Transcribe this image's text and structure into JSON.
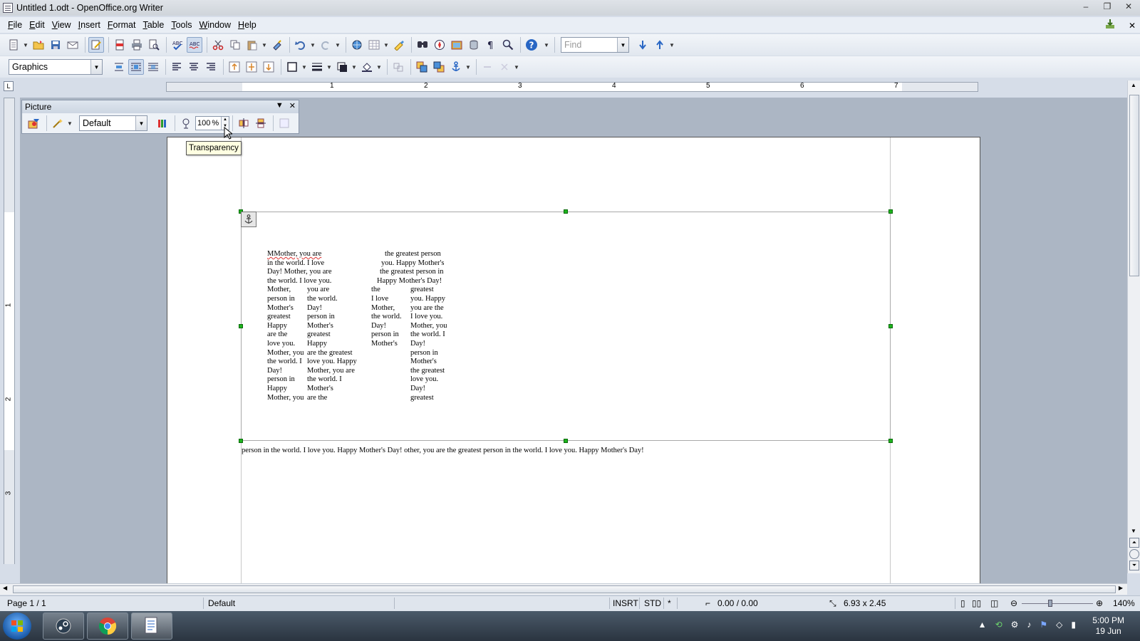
{
  "window": {
    "title": "Untitled 1.odt - OpenOffice.org Writer",
    "controls": [
      "–",
      "❐",
      "✕"
    ]
  },
  "menu": {
    "items": [
      {
        "first": "F",
        "rest": "ile"
      },
      {
        "first": "E",
        "rest": "dit"
      },
      {
        "first": "V",
        "rest": "iew"
      },
      {
        "first": "I",
        "rest": "nsert"
      },
      {
        "first": "F",
        "rest": "ormat"
      },
      {
        "first": "T",
        "rest": "able"
      },
      {
        "first": "T",
        "rest": "ools"
      },
      {
        "first": "W",
        "rest": "indow"
      },
      {
        "first": "H",
        "rest": "elp"
      }
    ],
    "close_doc": "✕"
  },
  "toolbar": {
    "find_placeholder": "Find",
    "style_value": "Graphics"
  },
  "ruler": {
    "h_numbers": [
      "1",
      "2",
      "3",
      "4",
      "5",
      "6",
      "7"
    ],
    "v_numbers": [
      "1",
      "2",
      "3"
    ],
    "corner": "L"
  },
  "picture_toolbar": {
    "title": "Picture",
    "graphics_mode": "Default",
    "transparency_value": "100",
    "transparency_unit": "%",
    "tooltip": "Transparency"
  },
  "document": {
    "poem_lines": [
      {
        "text": "MMother, you are",
        "row": 0,
        "col": 0
      },
      {
        "text": "the greatest person",
        "row": 0,
        "col": 3
      },
      {
        "text": "in the world. I love",
        "row": 1,
        "col": 0
      },
      {
        "text": "you. Happy Mother's",
        "row": 1,
        "col": 3
      },
      {
        "text": "Day! Mother, you are",
        "row": 2,
        "col": 0
      },
      {
        "text": "the greatest person in",
        "row": 2,
        "col": 3
      },
      {
        "text": "the world. I love you.",
        "row": 3,
        "col": 0
      },
      {
        "text": "Happy Mother's Day!",
        "row": 3,
        "col": 3
      },
      {
        "text": "Mother,",
        "row": 4,
        "col": 0
      },
      {
        "text": "you are",
        "row": 4,
        "col": 1
      },
      {
        "text": "the",
        "row": 4,
        "col": 2
      },
      {
        "text": "greatest",
        "row": 4,
        "col": 4
      },
      {
        "text": "person in",
        "row": 5,
        "col": 0
      },
      {
        "text": "the world.",
        "row": 5,
        "col": 1
      },
      {
        "text": "I love",
        "row": 5,
        "col": 2
      },
      {
        "text": "you. Happy",
        "row": 5,
        "col": 4
      },
      {
        "text": "Mother's",
        "row": 6,
        "col": 0
      },
      {
        "text": "Day!",
        "row": 6,
        "col": 1
      },
      {
        "text": "Mother,",
        "row": 6,
        "col": 2
      },
      {
        "text": "you are the",
        "row": 6,
        "col": 4
      },
      {
        "text": "greatest",
        "row": 7,
        "col": 0
      },
      {
        "text": "person in",
        "row": 7,
        "col": 1
      },
      {
        "text": "the world.",
        "row": 7,
        "col": 2
      },
      {
        "text": "I love you.",
        "row": 7,
        "col": 4
      },
      {
        "text": "Happy",
        "row": 8,
        "col": 0
      },
      {
        "text": "Mother's",
        "row": 8,
        "col": 1
      },
      {
        "text": "Day!",
        "row": 8,
        "col": 2
      },
      {
        "text": "Mother, you",
        "row": 8,
        "col": 4
      },
      {
        "text": "are the",
        "row": 9,
        "col": 0
      },
      {
        "text": "greatest",
        "row": 9,
        "col": 1
      },
      {
        "text": "person in",
        "row": 9,
        "col": 2
      },
      {
        "text": "the world. I",
        "row": 9,
        "col": 4
      },
      {
        "text": "love you.",
        "row": 10,
        "col": 0
      },
      {
        "text": "Happy",
        "row": 10,
        "col": 1
      },
      {
        "text": "Mother's",
        "row": 10,
        "col": 2
      },
      {
        "text": "Day!",
        "row": 10,
        "col": 4
      },
      {
        "text": "Mother, you",
        "row": 11,
        "col": 0
      },
      {
        "text": "are the greatest",
        "row": 11,
        "col": 1
      },
      {
        "text": "person in",
        "row": 11,
        "col": 4
      },
      {
        "text": "the world. I",
        "row": 12,
        "col": 0
      },
      {
        "text": "love you. Happy",
        "row": 12,
        "col": 1
      },
      {
        "text": "Mother's",
        "row": 12,
        "col": 4
      },
      {
        "text": "Day!",
        "row": 13,
        "col": 0
      },
      {
        "text": "Mother, you are",
        "row": 13,
        "col": 1
      },
      {
        "text": "the greatest",
        "row": 13,
        "col": 4
      },
      {
        "text": "person in",
        "row": 14,
        "col": 0
      },
      {
        "text": "the world. I",
        "row": 14,
        "col": 1
      },
      {
        "text": "love you.",
        "row": 14,
        "col": 4
      },
      {
        "text": "Happy",
        "row": 15,
        "col": 0
      },
      {
        "text": "Mother's",
        "row": 15,
        "col": 1
      },
      {
        "text": "Day!",
        "row": 15,
        "col": 4
      },
      {
        "text": "Mother, you",
        "row": 16,
        "col": 0
      },
      {
        "text": "are the",
        "row": 16,
        "col": 1
      },
      {
        "text": "greatest",
        "row": 16,
        "col": 4
      }
    ],
    "body_text": "person in the world. I love you. Happy Mother's Day! other, you are the greatest person in the world. I love you. Happy Mother's Day!"
  },
  "status": {
    "page": "Page 1 / 1",
    "style": "Default",
    "insert_mode": "INSRT",
    "selection_mode": "STD",
    "modified": "*",
    "position": "0.00 / 0.00",
    "size": "6.93 x 2.45",
    "zoom": "140%",
    "zoom_level": 0.4
  },
  "taskbar": {
    "time": "5:00 PM",
    "date": "19 Jun"
  },
  "colors": {
    "handle": "#1db31d",
    "tooltip_bg": "#ffffe1",
    "doc_background": "#acb6c4"
  }
}
